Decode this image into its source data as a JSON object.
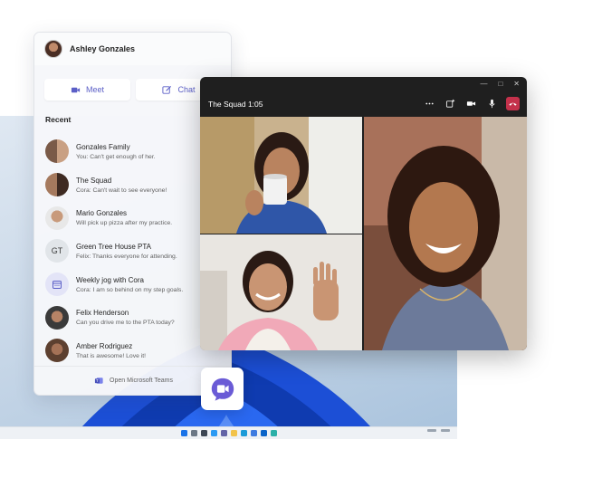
{
  "user": {
    "name": "Ashley Gonzales"
  },
  "actions": {
    "meet_label": "Meet",
    "chat_label": "Chat"
  },
  "recent": {
    "label": "Recent",
    "chats": [
      {
        "name": "Gonzales Family",
        "preview": "You: Can't get enough of her."
      },
      {
        "name": "The Squad",
        "preview": "Cora: Can't wait to see everyone!"
      },
      {
        "name": "Mario Gonzales",
        "preview": "Will pick up pizza after my practice."
      },
      {
        "name": "Green Tree House PTA",
        "initials": "GT",
        "preview": "Felix: Thanks everyone for attending."
      },
      {
        "name": "Weekly jog with Cora",
        "preview": "Cora: I am so behind on my step goals."
      },
      {
        "name": "Felix Henderson",
        "preview": "Can you drive me to the PTA today?"
      },
      {
        "name": "Amber Rodriguez",
        "preview": "That is awesome! Love it!"
      }
    ]
  },
  "footer": {
    "open_teams_label": "Open Microsoft Teams"
  },
  "call": {
    "title": "The Squad 1:05",
    "window_controls": [
      "minimize",
      "maximize",
      "close"
    ],
    "icons": [
      "more-icon",
      "add-people-icon",
      "camera-icon",
      "mic-icon",
      "hang-up-icon"
    ]
  },
  "colors": {
    "accent": "#5b5fc7",
    "hangup": "#c4314b",
    "call_bg": "#1f1f1f"
  }
}
